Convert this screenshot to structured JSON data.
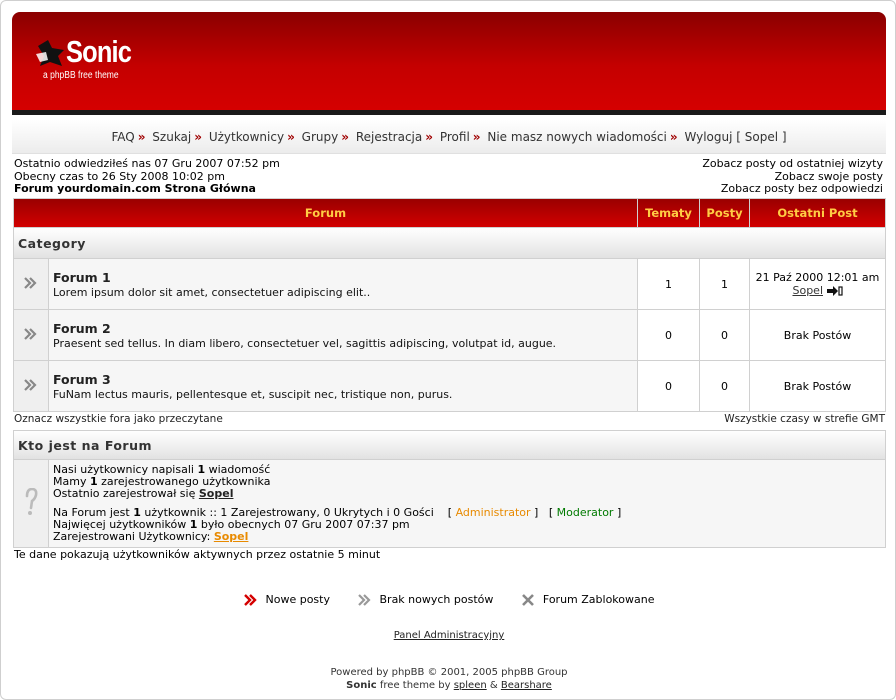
{
  "header": {
    "title": "Sonic",
    "subtitle": "a phpBB free theme"
  },
  "nav": [
    {
      "label": "FAQ"
    },
    {
      "label": "Szukaj"
    },
    {
      "label": "Użytkownicy"
    },
    {
      "label": "Grupy"
    },
    {
      "label": "Rejestracja"
    },
    {
      "label": "Profil"
    },
    {
      "label": "Nie masz nowych wiadomości"
    },
    {
      "label": "Wyloguj [ Sopel ]"
    }
  ],
  "info": {
    "last_visit": "Ostatnio odwiedziłeś nas 07 Gru 2007 07:52 pm",
    "current_time": "Obecny czas to 26 Sty 2008 10:02 pm",
    "breadcrumb": "Forum yourdomain.com Strona Główna",
    "links": [
      "Zobacz posty od ostatniej wizyty",
      "Zobacz swoje posty",
      "Zobacz posty bez odpowiedzi"
    ]
  },
  "table": {
    "headers": [
      "Forum",
      "Tematy",
      "Posty",
      "Ostatni Post"
    ],
    "category": "Category",
    "forums": [
      {
        "name": "Forum 1",
        "desc": "Lorem ipsum dolor sit amet, consectetuer adipiscing elit..",
        "topics": "1",
        "posts": "1",
        "last_date": "21 Paź 2000 12:01 am",
        "last_user": "Sopel"
      },
      {
        "name": "Forum 2",
        "desc": "Praesent sed tellus. In diam libero, consectetuer vel, sagittis adipiscing, volutpat id, augue.",
        "topics": "0",
        "posts": "0",
        "last_text": "Brak Postów"
      },
      {
        "name": "Forum 3",
        "desc": "FuNam lectus mauris, pellentesque et, suscipit nec, tristique non, purus.",
        "topics": "0",
        "posts": "0",
        "last_text": "Brak Postów"
      }
    ]
  },
  "mark_read": "Oznacz wszystkie fora jako przeczytane",
  "timezone": "Wszystkie czasy w strefie GMT",
  "who": {
    "title": "Kto jest na Forum",
    "line1_a": "Nasi użytkownicy napisali ",
    "line1_b": "1",
    "line1_c": " wiadomość",
    "line2_a": "Mamy ",
    "line2_b": "1",
    "line2_c": " zarejestrowanego użytkownika",
    "line3_a": "Ostatnio zarejestrował się ",
    "line3_user": "Sopel",
    "online_a": "Na Forum jest ",
    "online_b": "1",
    "online_c": " użytkownik :: 1 Zarejestrowany, 0 Ukrytych i 0 Gości",
    "admin_label": "Administrator",
    "mod_label": "Moderator",
    "record_a": "Najwięcej użytkowników ",
    "record_b": "1",
    "record_c": " było obecnych 07 Gru 2007 07:37 pm",
    "registered_a": "Zarejestrowani Użytkownicy: ",
    "registered_user": "Sopel"
  },
  "note": "Te dane pokazują użytkowników aktywnych przez ostatnie 5 minut",
  "legend": {
    "new_posts": "Nowe posty",
    "no_new": "Brak nowych postów",
    "locked": "Forum Zablokowane"
  },
  "admin_panel": "Panel Administracyjny",
  "footer": {
    "powered": "Powered by phpBB © 2001, 2005 phpBB Group",
    "theme_name": "Sonic",
    "theme_text": " free theme by ",
    "author1": "spleen",
    "amp": " & ",
    "author2": "Bearshare"
  },
  "colors": {
    "header_red": "#c40000",
    "header_dark": "#8a0000",
    "th_text": "#ffcc44",
    "admin": "#e88a00",
    "moderator": "#007a00"
  }
}
